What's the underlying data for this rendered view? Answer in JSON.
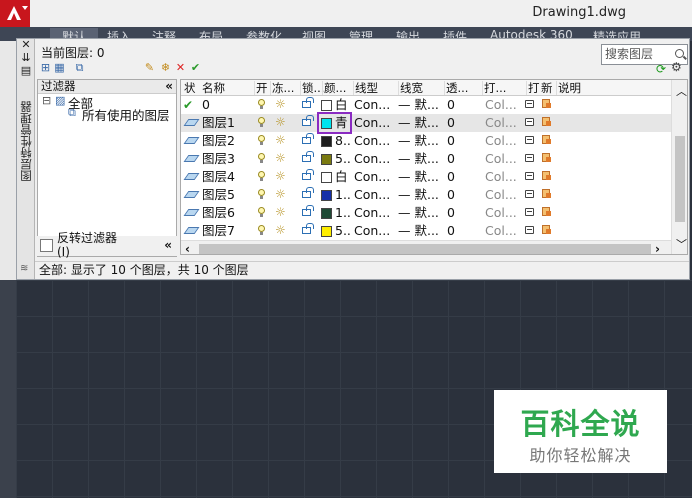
{
  "window": {
    "doc_title": "Drawing1.dwg"
  },
  "ribbon_tabs": [
    "默认",
    "插入",
    "注释",
    "布局",
    "参数化",
    "视图",
    "管理",
    "输出",
    "插件",
    "Autodesk 360",
    "精选应用"
  ],
  "palette": {
    "title": "图层特性管理器",
    "current_layer": "当前图层: 0",
    "search_placeholder": "搜索图层",
    "status": "全部: 显示了 10 个图层，共 10 个图层"
  },
  "filters": {
    "header": "过滤器",
    "collapse": "«",
    "tree": [
      "全部",
      "所有使用的图层"
    ],
    "invert_label": "反转过滤器",
    "invert_label_2": "(I)"
  },
  "table": {
    "columns": [
      "状",
      "名称",
      "开",
      "冻...",
      "锁...",
      "颜...",
      "线型",
      "线宽",
      "透...",
      "打...",
      "打",
      "新",
      "说明"
    ],
    "rows": [
      {
        "status": "current",
        "name": "0",
        "color_name": "白",
        "color": "#ffffff",
        "linetype": "Con...",
        "lineweight": "— 默...",
        "transparency": "0",
        "plot_style": "Col..."
      },
      {
        "status": "layer",
        "name": "图层1",
        "color_name": "青",
        "color": "#00e5ee",
        "linetype": "Con...",
        "lineweight": "— 默...",
        "transparency": "0",
        "plot_style": "Col...",
        "selected": true
      },
      {
        "status": "layer",
        "name": "图层2",
        "color_name": "8..",
        "color": "#1e1e1e",
        "linetype": "Con...",
        "lineweight": "— 默...",
        "transparency": "0",
        "plot_style": "Col..."
      },
      {
        "status": "layer",
        "name": "图层3",
        "color_name": "5..",
        "color": "#7a7a10",
        "linetype": "Con...",
        "lineweight": "— 默...",
        "transparency": "0",
        "plot_style": "Col..."
      },
      {
        "status": "layer",
        "name": "图层4",
        "color_name": "白",
        "color": "#ffffff",
        "linetype": "Con...",
        "lineweight": "— 默...",
        "transparency": "0",
        "plot_style": "Col..."
      },
      {
        "status": "layer",
        "name": "图层5",
        "color_name": "1..",
        "color": "#1530a8",
        "linetype": "Con...",
        "lineweight": "— 默...",
        "transparency": "0",
        "plot_style": "Col..."
      },
      {
        "status": "layer",
        "name": "图层6",
        "color_name": "1..",
        "color": "#1f4a35",
        "linetype": "Con...",
        "lineweight": "— 默...",
        "transparency": "0",
        "plot_style": "Col..."
      },
      {
        "status": "layer",
        "name": "图层7",
        "color_name": "5..",
        "color": "#ffee00",
        "linetype": "Con...",
        "lineweight": "— 默...",
        "transparency": "0",
        "plot_style": "Col..."
      }
    ]
  },
  "watermark": {
    "title": "百科全说",
    "subtitle": "助你轻松解决"
  },
  "colors": {
    "accent_highlight": "#8a2bc2",
    "watermark_green": "#2fa84f",
    "canvas": "#2b313c"
  }
}
